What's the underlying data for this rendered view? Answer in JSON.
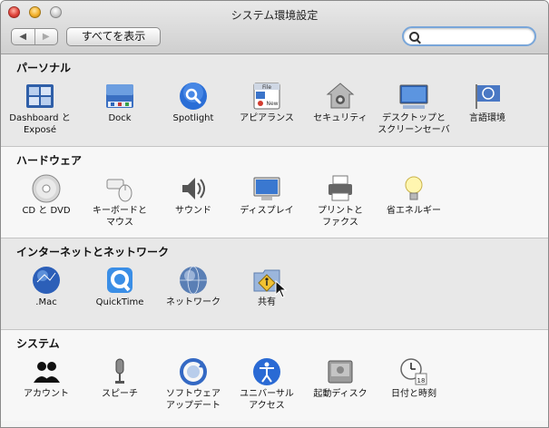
{
  "window": {
    "title": "システム環境設定"
  },
  "toolbar": {
    "back_glyph": "◀",
    "forward_glyph": "▶",
    "show_all_label": "すべてを表示",
    "search_value": ""
  },
  "sections": [
    {
      "title": "パーソナル",
      "items": [
        {
          "label": "Dashboard と\nExposé",
          "icon": "dashboard-expose-icon"
        },
        {
          "label": "Dock",
          "icon": "dock-icon"
        },
        {
          "label": "Spotlight",
          "icon": "spotlight-icon"
        },
        {
          "label": "アピアランス",
          "icon": "appearance-icon"
        },
        {
          "label": "セキュリティ",
          "icon": "security-icon"
        },
        {
          "label": "デスクトップと\nスクリーンセーバ",
          "icon": "desktop-screensaver-icon"
        },
        {
          "label": "言語環境",
          "icon": "international-icon"
        }
      ]
    },
    {
      "title": "ハードウェア",
      "items": [
        {
          "label": "CD と DVD",
          "icon": "cd-dvd-icon"
        },
        {
          "label": "キーボードと\nマウス",
          "icon": "keyboard-mouse-icon"
        },
        {
          "label": "サウンド",
          "icon": "sound-icon"
        },
        {
          "label": "ディスプレイ",
          "icon": "displays-icon"
        },
        {
          "label": "プリントと\nファクス",
          "icon": "print-fax-icon"
        },
        {
          "label": "省エネルギー",
          "icon": "energy-saver-icon"
        }
      ]
    },
    {
      "title": "インターネットとネットワーク",
      "items": [
        {
          "label": ".Mac",
          "icon": "dotmac-icon"
        },
        {
          "label": "QuickTime",
          "icon": "quicktime-icon"
        },
        {
          "label": "ネットワーク",
          "icon": "network-icon"
        },
        {
          "label": "共有",
          "icon": "sharing-icon"
        }
      ]
    },
    {
      "title": "システム",
      "items": [
        {
          "label": "アカウント",
          "icon": "accounts-icon"
        },
        {
          "label": "スピーチ",
          "icon": "speech-icon"
        },
        {
          "label": "ソフトウェア\nアップデート",
          "icon": "software-update-icon"
        },
        {
          "label": "ユニバーサル\nアクセス",
          "icon": "universal-access-icon"
        },
        {
          "label": "起動ディスク",
          "icon": "startup-disk-icon"
        },
        {
          "label": "日付と時刻",
          "icon": "date-time-icon"
        }
      ]
    }
  ],
  "date_time_icon_day": "18",
  "colors": {
    "search_focus": "#79a6d9",
    "titlebar_top": "#e9e9e9",
    "titlebar_bottom": "#cfcfcf"
  }
}
